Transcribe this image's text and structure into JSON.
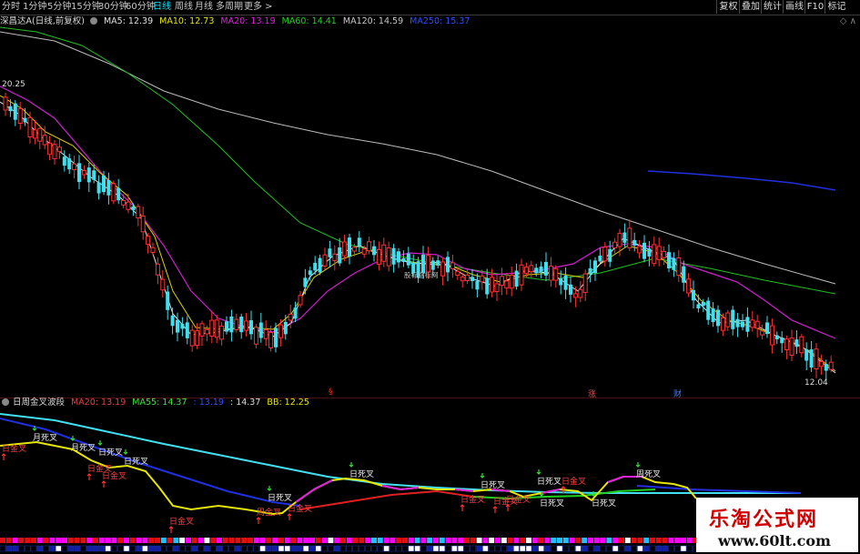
{
  "toolbar": {
    "tabs": [
      "分时",
      "1分钟",
      "5分钟",
      "15分钟",
      "30分钟",
      "60分钟",
      "日线",
      "周线",
      "月线",
      "多周期",
      "更多 >"
    ],
    "active_tab": "日线",
    "right_buttons": [
      "复权",
      "叠加",
      "统计",
      "画线",
      "F10",
      "标记"
    ]
  },
  "header": {
    "stock_name": "深昌达A(日线,前复权)",
    "ma5": "MA5: 12.39",
    "ma10": "MA10: 12.73",
    "ma20": "MA20: 13.19",
    "ma60": "MA60: 14.41",
    "ma120": "MA120: 14.59",
    "ma250": "MA250: 15.37",
    "corner": "◇ ∧"
  },
  "price_labels": {
    "high": "20.25",
    "low": "12.04"
  },
  "event_markers": [
    "§",
    "涨",
    "财"
  ],
  "watermark": "股标指标网",
  "indicator": {
    "name": "日周金叉波段",
    "ma20": "MA20: 13.19",
    "ma55": "MA55: 14.37",
    "v3": ": 13.19",
    "v4": ": 14.37",
    "bb": "BB: 12.25",
    "signals": [
      {
        "text": "日金叉",
        "type": "gold"
      },
      {
        "text": "月死叉",
        "type": "dead"
      },
      {
        "text": "月死叉",
        "type": "dead"
      },
      {
        "text": "日死叉",
        "type": "dead"
      },
      {
        "text": "日金叉",
        "type": "gold"
      },
      {
        "text": "日金叉",
        "type": "gold"
      },
      {
        "text": "日死叉",
        "type": "dead"
      },
      {
        "text": "日金叉",
        "type": "gold"
      },
      {
        "text": "周金叉",
        "type": "gold"
      },
      {
        "text": "日死叉",
        "type": "dead"
      },
      {
        "text": "日金叉",
        "type": "gold"
      },
      {
        "text": "日死叉",
        "type": "dead"
      },
      {
        "text": "日死叉",
        "type": "dead"
      },
      {
        "text": "日金叉",
        "type": "gold"
      },
      {
        "text": "日金叉",
        "type": "gold"
      },
      {
        "text": "日金叉",
        "type": "gold"
      },
      {
        "text": "日死叉",
        "type": "dead"
      },
      {
        "text": "日死叉",
        "type": "dead"
      },
      {
        "text": "日金叉",
        "type": "gold"
      },
      {
        "text": "日死叉",
        "type": "dead"
      },
      {
        "text": "周死叉",
        "type": "dead"
      }
    ]
  },
  "logo": {
    "title": "乐淘公式网",
    "url": "www.60lt.com"
  },
  "colors": {
    "up": "#ff3030",
    "down": "#3ee0f0",
    "ma5": "#e0e0e0",
    "ma10": "#e6e600",
    "ma20": "#e020e0",
    "ma60": "#20d020",
    "ma120": "#c8c8c8",
    "ma250": "#2040ff"
  }
}
